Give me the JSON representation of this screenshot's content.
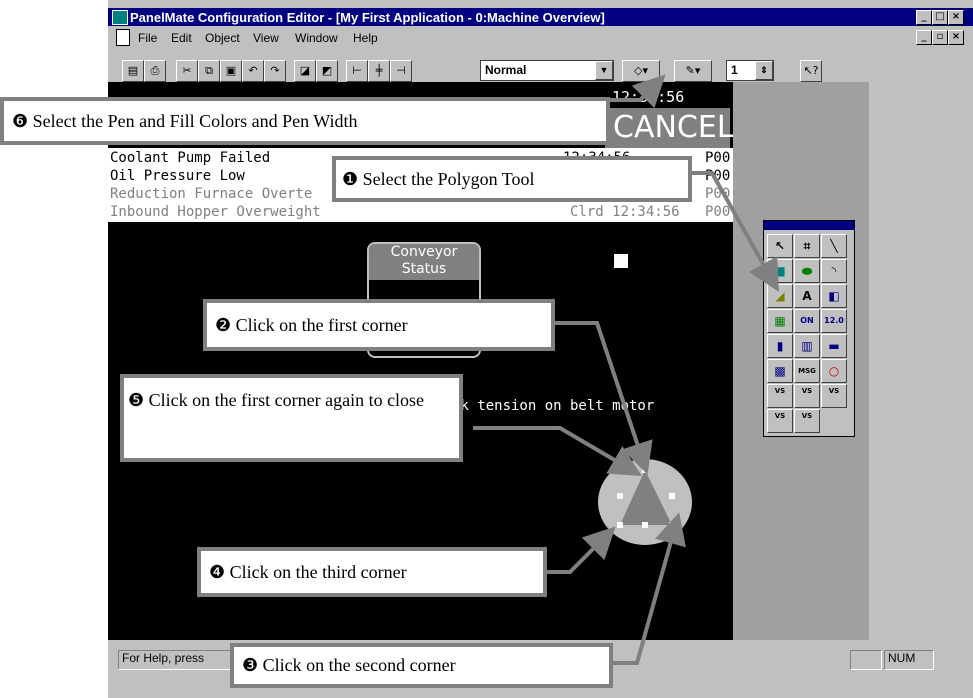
{
  "window": {
    "title": "PanelMate Configuration Editor - [My First Application - 0:Machine Overview]"
  },
  "menu": [
    "File",
    "Edit",
    "Object",
    "View",
    "Window",
    "Help"
  ],
  "toolbar": {
    "style_select": "Normal",
    "pen_width": "1"
  },
  "screen": {
    "clock": "12:34:56",
    "cancel_label": "CANCEL",
    "alarms": [
      {
        "text": "Coolant Pump Failed",
        "time": "12:34:56",
        "code": "P00"
      },
      {
        "text": "Oil Pressure Low",
        "time": "",
        "code": "P00"
      },
      {
        "text": "Reduction Furnace Overte",
        "time": "",
        "code": "P00"
      },
      {
        "text": "Inbound Hopper Overweight",
        "time": "Clrd 12:34:56",
        "code": "P00"
      }
    ],
    "conveyor_status": "Conveyor\nStatus",
    "message_text": "ck tension on belt motor"
  },
  "palette": {
    "text_tool": "A",
    "on_label": "ON",
    "value_label": "12.0",
    "msg_label": "MSG",
    "vs_label": "VS"
  },
  "statusbar": {
    "help": "For Help, press",
    "num": "NUM"
  },
  "callouts": {
    "c1": "❶ Select the Polygon Tool",
    "c2": "❷ Click on the first corner",
    "c3": "❸ Click on the second corner",
    "c4": "❹ Click on the third corner",
    "c5": "❺ Click on the first corner again to close",
    "c6": "❻ Select the Pen and Fill Colors and Pen Width"
  },
  "colors": {
    "title_bar": "#000080",
    "callout_border": "#808080",
    "screen_bg": "#000000",
    "polygon_fill": "#808080",
    "circle_fill": "#c0c0c0"
  }
}
